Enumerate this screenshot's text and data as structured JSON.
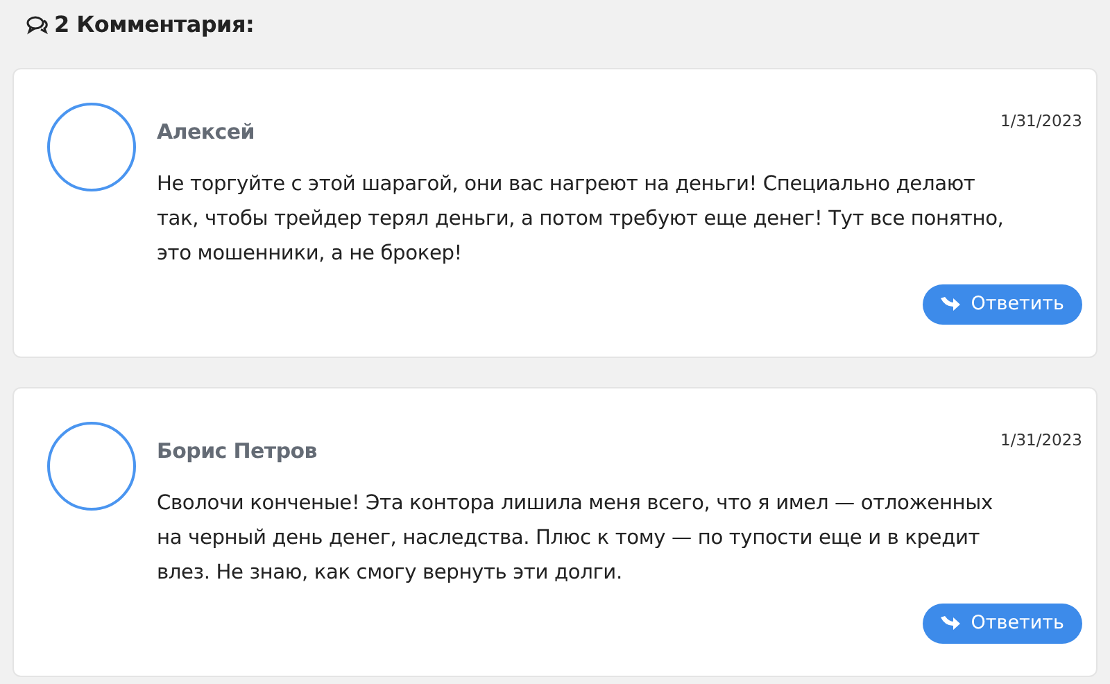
{
  "heading": "2 Комментария:",
  "comments": [
    {
      "author": "Алексей",
      "date": "1/31/2023",
      "lines": [
        "Не торгуйте с этой шарагой, они вас нагреют на деньги! Специально делают",
        "так, чтобы трейдер терял деньги, а потом требуют еще денег! Тут все понятно,",
        "это мошенники, а не брокер!"
      ],
      "reply": "Ответить"
    },
    {
      "author": "Борис Петров",
      "date": "1/31/2023",
      "lines": [
        "Сволочи конченые! Эта контора лишила меня всего, что я имел — отложенных",
        "на черный день денег, наследства. Плюс к тому — по тупости еще и в кредит",
        "влез. Не знаю, как смогу вернуть эти долги."
      ],
      "reply": "Ответить"
    }
  ]
}
